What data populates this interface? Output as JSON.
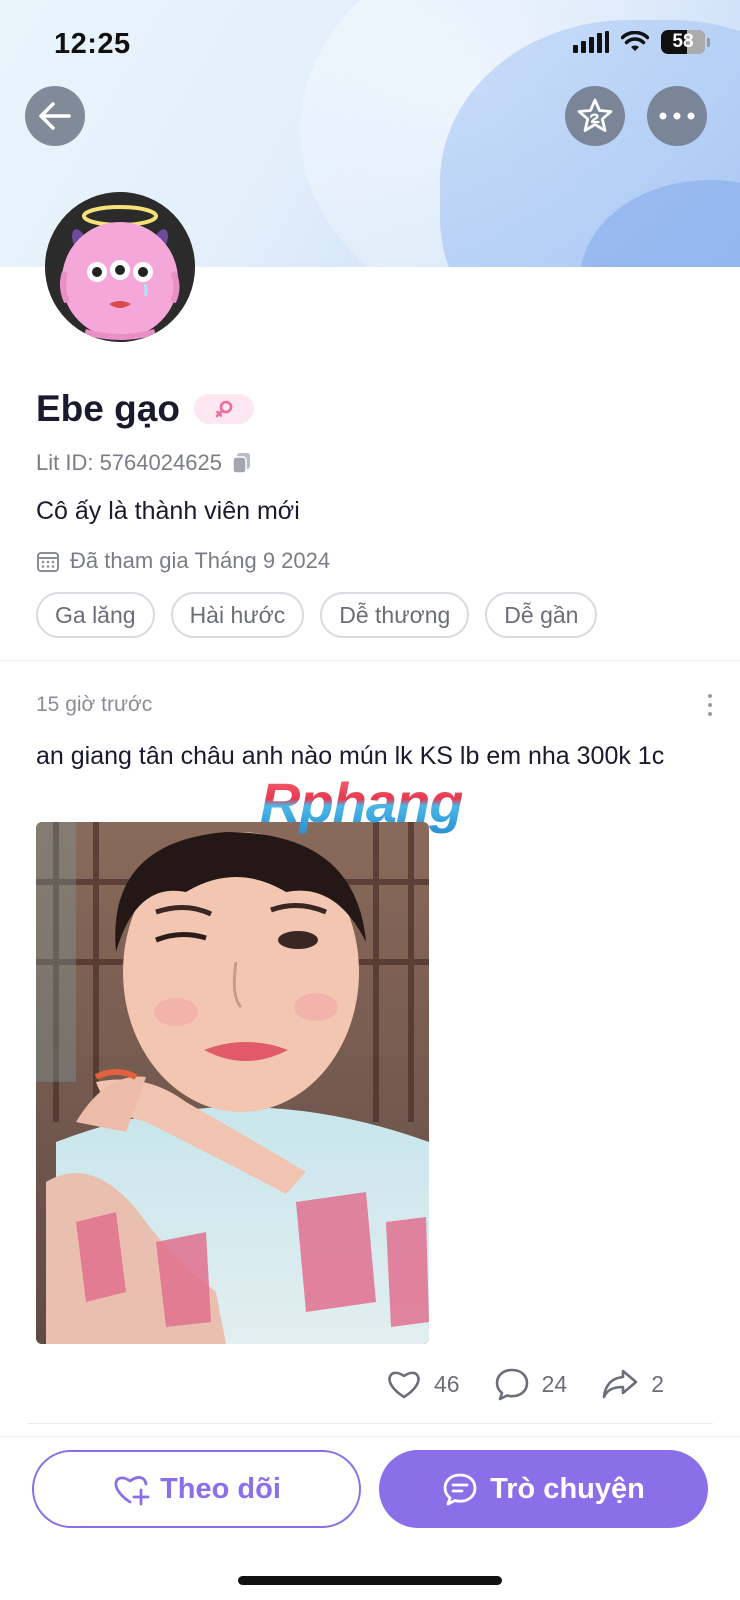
{
  "status_bar": {
    "time": "12:25",
    "battery": "58"
  },
  "header": {
    "back_icon": "arrow-left-icon",
    "star_icon": "star-icon",
    "more_icon": "more-horizontal-icon"
  },
  "profile": {
    "name": "Ebe gạo",
    "gender_icon": "female-icon",
    "lit_id": "Lit ID: 5764024625",
    "bio": "Cô ấy là thành viên mới",
    "joined": "Đã tham gia Tháng 9 2024",
    "tags": [
      "Ga lăng",
      "Hài hước",
      "Dễ thương",
      "Dễ gần"
    ]
  },
  "post": {
    "time": "15 giờ trước",
    "text": "an giang tân châu anh nào mún lk KS lb em nha 300k 1c",
    "likes": "46",
    "comments": "24",
    "shares": "2"
  },
  "watermark": "Rphang",
  "buttons": {
    "follow": "Theo dõi",
    "chat": "Trò chuyện"
  },
  "colors": {
    "accent": "#8b6fe8",
    "badge_bg": "#fde8f1",
    "badge_fg": "#f06aa0"
  }
}
